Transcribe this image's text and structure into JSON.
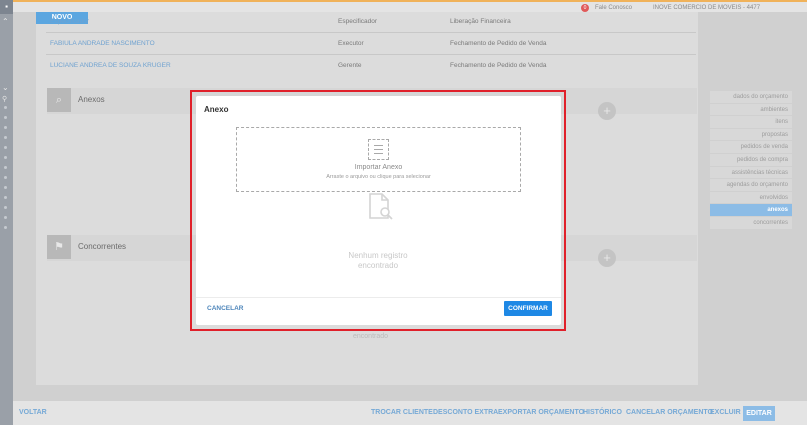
{
  "header": {
    "new_button": "NOVO",
    "notification_count": "0",
    "contact_label": "Fale Conosco",
    "company": "INOVE COMERCIO DE MOVEIS - 4477"
  },
  "participants": [
    {
      "name": "Especificador",
      "role": "Especificador",
      "stage": "Liberação Financeira"
    },
    {
      "name": "FABIULA ANDRADE NASCIMENTO",
      "role": "Executor",
      "stage": "Fechamento de Pedido de Venda"
    },
    {
      "name": "LUCIANE ANDREA DE SOUZA KRUGER",
      "role": "Gerente",
      "stage": "Fechamento de Pedido de Venda"
    }
  ],
  "sections": {
    "anexos": "Anexos",
    "concorrentes": "Concorrentes",
    "ghost_empty": "encontrado"
  },
  "right_nav": [
    "dados do orçamento",
    "ambientes",
    "itens",
    "propostas",
    "pedidos de venda",
    "pedidos de compra",
    "assistências técnicas",
    "agendas do orçamento",
    "envolvidos",
    "anexos",
    "concorrentes"
  ],
  "right_nav_active_index": 9,
  "bottom_bar": {
    "back": "VOLTAR",
    "actions": [
      "TROCAR CLIENTE",
      "DESCONTO EXTRA",
      "EXPORTAR ORÇAMENTO",
      "HISTÓRICO",
      "CANCELAR ORÇAMENTO",
      "EXCLUIR"
    ],
    "edit": "EDITAR"
  },
  "modal": {
    "title": "Anexo",
    "import_title": "Importar Anexo",
    "import_hint": "Arraste o arquivo ou clique para selecionar",
    "empty_line1": "Nenhum registro",
    "empty_line2": "encontrado",
    "cancel": "CANCELAR",
    "confirm": "CONFIRMAR"
  },
  "colors": {
    "accent": "#1e88e5",
    "highlight_border": "#e0202a",
    "link": "#4e86bb"
  }
}
